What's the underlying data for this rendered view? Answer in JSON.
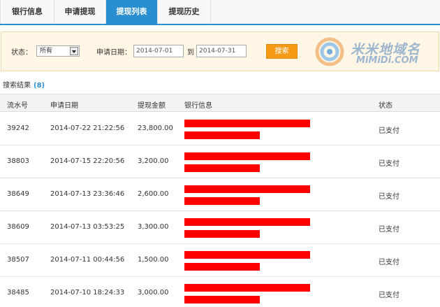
{
  "tabs": [
    {
      "label": "银行信息",
      "active": false
    },
    {
      "label": "申请提现",
      "active": false
    },
    {
      "label": "提现列表",
      "active": true
    },
    {
      "label": "提现历史",
      "active": false
    }
  ],
  "filter": {
    "status_label": "状态：",
    "status_value": "所有",
    "date_label": "申请日期：",
    "date_from": "2014-07-01",
    "to_label": "到",
    "date_to": "2014-07-31",
    "search_button": "搜索"
  },
  "logo": {
    "cn": "米米地域名",
    "en": "MiMiDi.COM"
  },
  "result": {
    "label": "搜索结果",
    "count": "(8)"
  },
  "table": {
    "headers": [
      "流水号",
      "申请日期",
      "提现金额",
      "银行信息",
      "状态"
    ],
    "rows": [
      {
        "id": "39242",
        "date": "2014-07-22 21:22:56",
        "amount": "23,800.00",
        "status": "已支付"
      },
      {
        "id": "38803",
        "date": "2014-07-15 22:20:56",
        "amount": "3,200.00",
        "status": "已支付"
      },
      {
        "id": "38649",
        "date": "2014-07-13 23:36:46",
        "amount": "2,600.00",
        "status": "已支付"
      },
      {
        "id": "38609",
        "date": "2014-07-13 03:53:25",
        "amount": "3,300.00",
        "status": "已支付"
      },
      {
        "id": "38507",
        "date": "2014-07-11 00:44:56",
        "amount": "1,500.00",
        "status": "已支付"
      },
      {
        "id": "38485",
        "date": "2014-07-10 18:24:33",
        "amount": "3,000.00",
        "status": "已支付"
      }
    ]
  },
  "colors": {
    "accent": "#2a8fd0",
    "button": "#f79a16",
    "redaction": "#ff0000",
    "filter_bg": "#fff6e6"
  }
}
